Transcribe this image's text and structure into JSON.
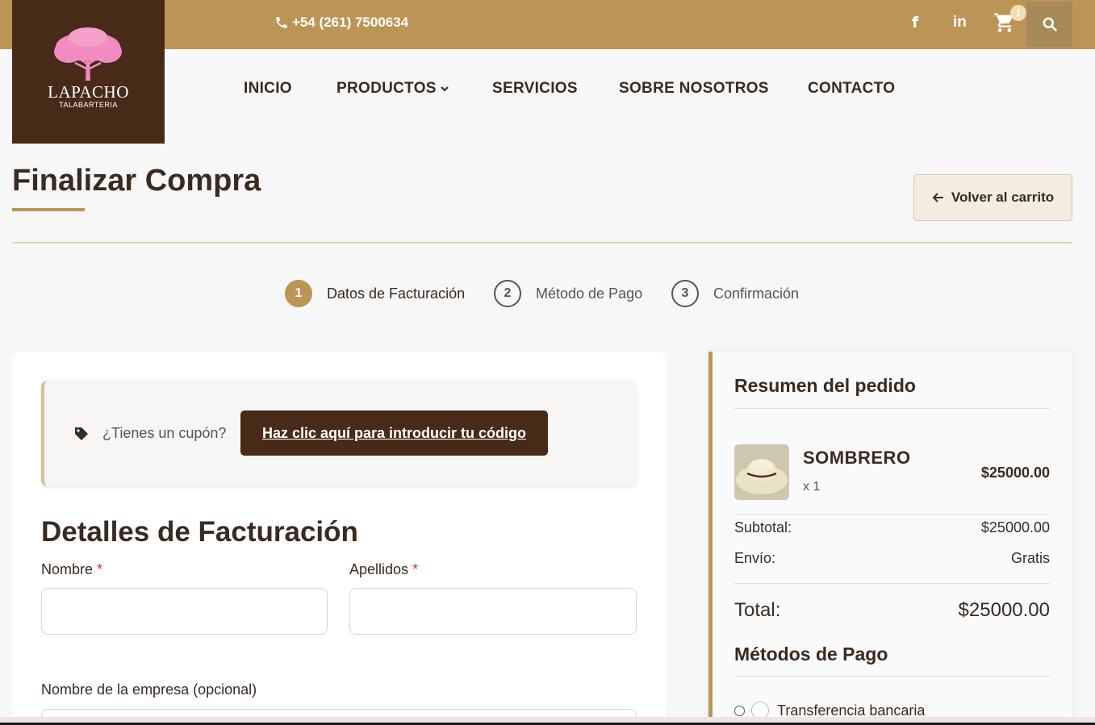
{
  "topbar": {
    "phone": "+54 (261) 7500634",
    "facebook_label": "f",
    "linkedin_label": "in",
    "cart_count": "1"
  },
  "logo": {
    "name": "LAPACHO",
    "tagline": "TALABARTERIA"
  },
  "nav": {
    "items": [
      "INICIO",
      "PRODUCTOS",
      "SERVICIOS",
      "SOBRE NOSOTROS",
      "CONTACTO"
    ]
  },
  "page": {
    "title": "Finalizar Compra",
    "back_label": "Volver al carrito"
  },
  "steps": [
    {
      "num": "1",
      "label": "Datos de Facturación"
    },
    {
      "num": "2",
      "label": "Método de Pago"
    },
    {
      "num": "3",
      "label": "Confirmación"
    }
  ],
  "coupon": {
    "question": "¿Tienes un cupón?",
    "link": "Haz clic aquí para introducir tu código"
  },
  "billing": {
    "title": "Detalles de Facturación",
    "first_name_label": "Nombre",
    "last_name_label": "Apellidos",
    "company_label": "Nombre de la empresa (opcional)",
    "required_mark": "*"
  },
  "summary": {
    "title": "Resumen del pedido",
    "product": {
      "name": "SOMBRERO",
      "qty": "x 1",
      "price": "$25000.00"
    },
    "subtotal_label": "Subtotal:",
    "subtotal_value": "$25000.00",
    "shipping_label": "Envío:",
    "shipping_value": "Gratis",
    "total_label": "Total:",
    "total_value": "$25000.00",
    "payment_title": "Métodos de Pago",
    "payment_option": "Transferencia bancaria"
  },
  "colors": {
    "brand_gold": "#bc9556",
    "brand_brown": "#482a18",
    "logo_pink": "#f08cc0"
  }
}
